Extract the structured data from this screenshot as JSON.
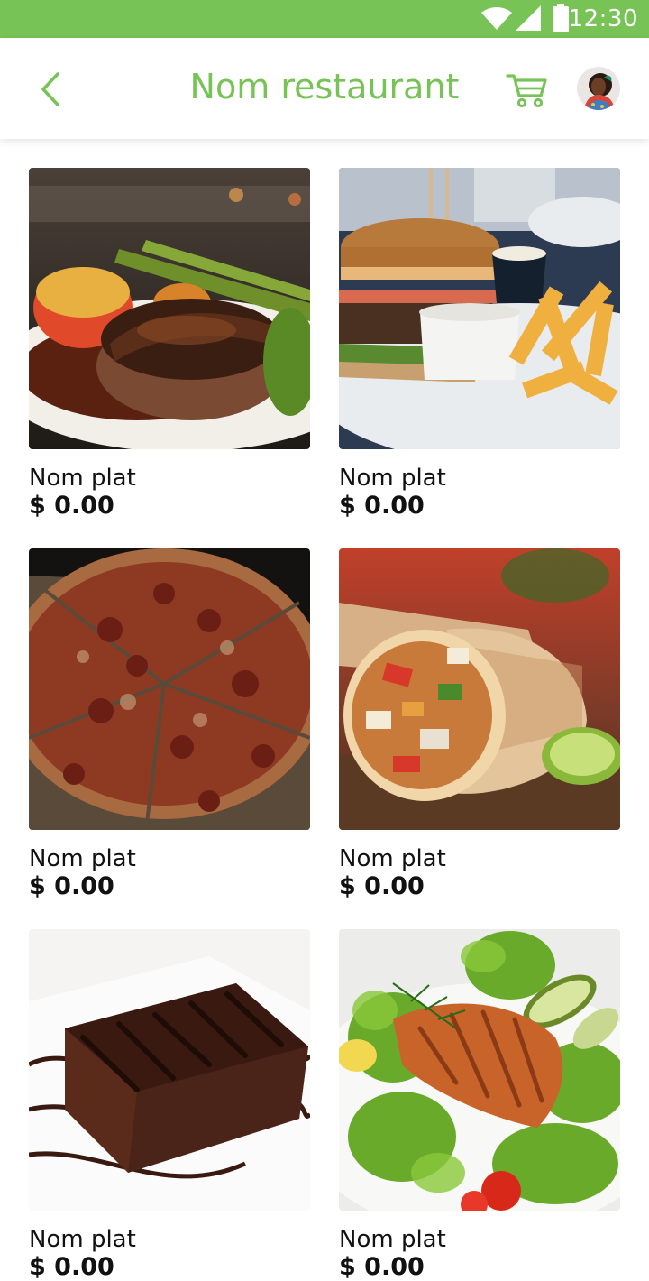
{
  "status_bar": {
    "time": "12:30",
    "icons": [
      "wifi-icon",
      "signal-icon",
      "battery-icon"
    ]
  },
  "app_bar": {
    "title": "Nom restaurant",
    "back_icon": "chevron-left-icon",
    "cart_icon": "cart-icon",
    "avatar_icon": "user-avatar"
  },
  "colors": {
    "accent": "#77c356",
    "text": "#111111",
    "background": "#ffffff"
  },
  "dishes": [
    {
      "name": "Nom plat",
      "price": "$ 0.00",
      "image": "steak-photo"
    },
    {
      "name": "Nom plat",
      "price": "$ 0.00",
      "image": "burger-photo"
    },
    {
      "name": "Nom plat",
      "price": "$ 0.00",
      "image": "pizza-photo"
    },
    {
      "name": "Nom plat",
      "price": "$ 0.00",
      "image": "burrito-photo"
    },
    {
      "name": "Nom plat",
      "price": "$ 0.00",
      "image": "chocolate-cake-photo"
    },
    {
      "name": "Nom plat",
      "price": "$ 0.00",
      "image": "salmon-salad-photo"
    }
  ]
}
